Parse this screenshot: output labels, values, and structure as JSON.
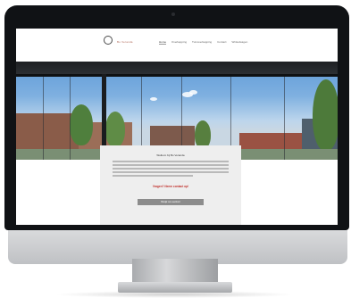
{
  "site": {
    "brand": "Bo Veranda",
    "nav": [
      "Home",
      "Overkapping",
      "Tuinoverkapping",
      "Contact",
      "Winkelwagen"
    ]
  },
  "card": {
    "title": "Welkom bij Bo Veranda",
    "question": "Vragen? Neem contact op!",
    "button_label": "Bekijk ons aanbod"
  },
  "colors": {
    "bezel": "#101215",
    "accent_red": "#c0302b",
    "sky": "#7fb0e0",
    "button_gray": "#8c8c8c"
  }
}
